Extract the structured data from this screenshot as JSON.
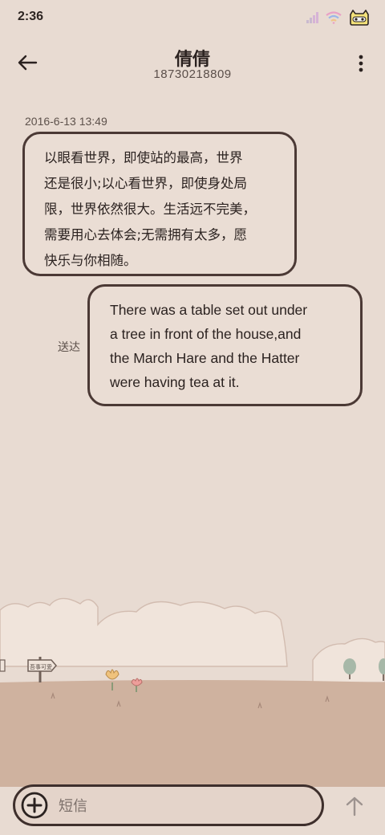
{
  "status_bar": {
    "time": "2:36"
  },
  "header": {
    "contact_name": "倩倩",
    "phone_number": "18730218809"
  },
  "messages": {
    "timestamp": "2016-6-13 13:49",
    "received": {
      "lines": [
        "以眼看世界，即使站的最高，世界",
        "还是很小;以心看世界，即使身处局",
        "限，世界依然很大。生活远不完美，",
        "需要用心去体会;无需拥有太多，愿",
        "快乐与你相随。"
      ]
    },
    "sent": {
      "status": "送达",
      "lines": [
        "There was a table set out under",
        "a tree in front of the house,and",
        "the March Hare and the Hatter",
        "were having tea at it."
      ]
    }
  },
  "scenery": {
    "sign_label": "吾事可愛"
  },
  "composer": {
    "placeholder": "短信"
  },
  "icons": {
    "back": "arrow-left-icon",
    "more": "more-vertical-icon",
    "add": "add-icon",
    "send": "arrow-up-icon",
    "signal": "signal-icon",
    "wifi": "wifi-icon",
    "battery": "battery-icon"
  },
  "colors": {
    "background": "#e8dbd2",
    "bubble_border": "#4b3935",
    "ground": "#cfb29f"
  }
}
